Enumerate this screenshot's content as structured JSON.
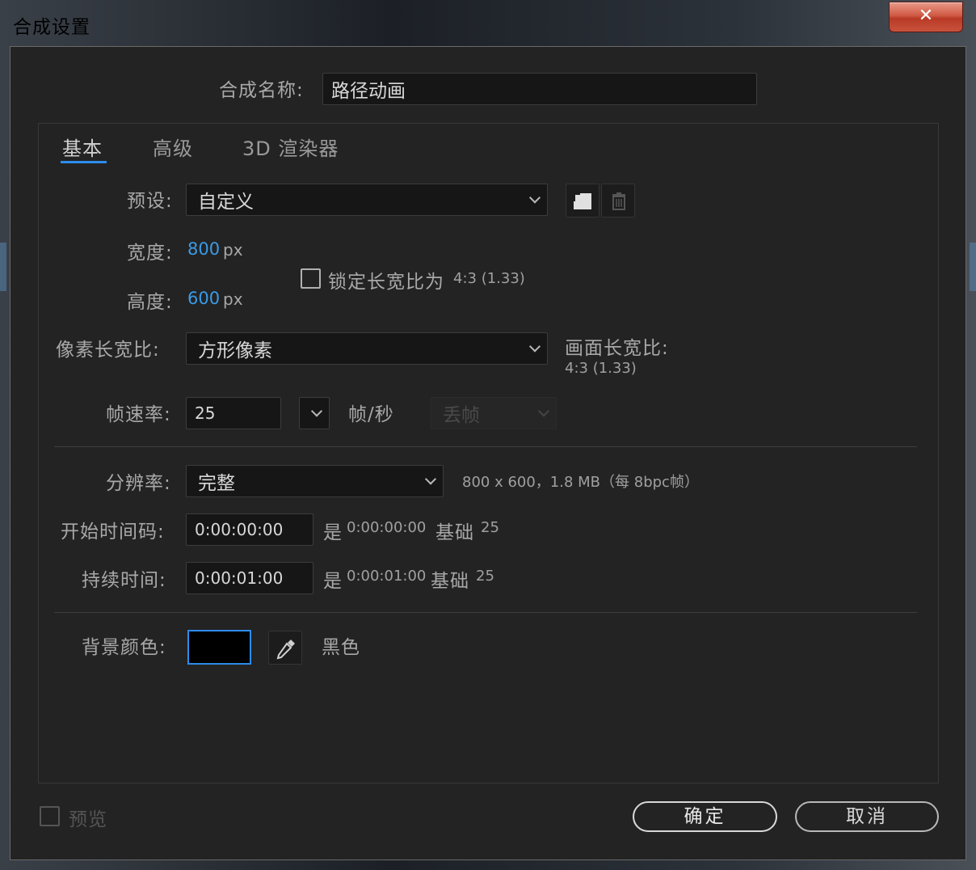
{
  "window": {
    "title": "合成设置",
    "close_label": "✕"
  },
  "comp_name": {
    "label": "合成名称:",
    "value": "路径动画"
  },
  "tabs": [
    {
      "label": "基本",
      "active": true
    },
    {
      "label": "高级",
      "active": false
    },
    {
      "label": "3D 渲染器",
      "active": false
    }
  ],
  "preset": {
    "label": "预设:",
    "value": "自定义"
  },
  "width": {
    "label": "宽度:",
    "value": "800",
    "unit": "px"
  },
  "height": {
    "label": "高度:",
    "value": "600",
    "unit": "px"
  },
  "lock_aspect": {
    "label": "锁定长宽比为",
    "ratio": "4:3 (1.33)",
    "checked": false
  },
  "pixel_aspect": {
    "label": "像素长宽比:",
    "value": "方形像素"
  },
  "frame_aspect": {
    "label": "画面长宽比:",
    "value": "4:3 (1.33)"
  },
  "frame_rate": {
    "label": "帧速率:",
    "value": "25",
    "unit": "帧/秒",
    "drop_frame": "丢帧"
  },
  "resolution": {
    "label": "分辨率:",
    "value": "完整",
    "info": "800 x 600，1.8 MB（每 8bpc帧）"
  },
  "start_timecode": {
    "label": "开始时间码:",
    "value": "0:00:00:00",
    "is_label": "是",
    "is_value": "0:00:00:00",
    "base_label": "基础",
    "base_value": "25"
  },
  "duration": {
    "label": "持续时间:",
    "value": "0:00:01:00",
    "is_label": "是",
    "is_value": "0:00:01:00",
    "base_label": "基础",
    "base_value": "25"
  },
  "background": {
    "label": "背景颜色:",
    "color": "#000000",
    "name": "黑色"
  },
  "preview": {
    "label": "预览",
    "checked": false
  },
  "buttons": {
    "ok": "确定",
    "cancel": "取消"
  },
  "colors": {
    "accent": "#2d8ceb",
    "value_blue": "#3a9be8",
    "background": "#232323"
  }
}
